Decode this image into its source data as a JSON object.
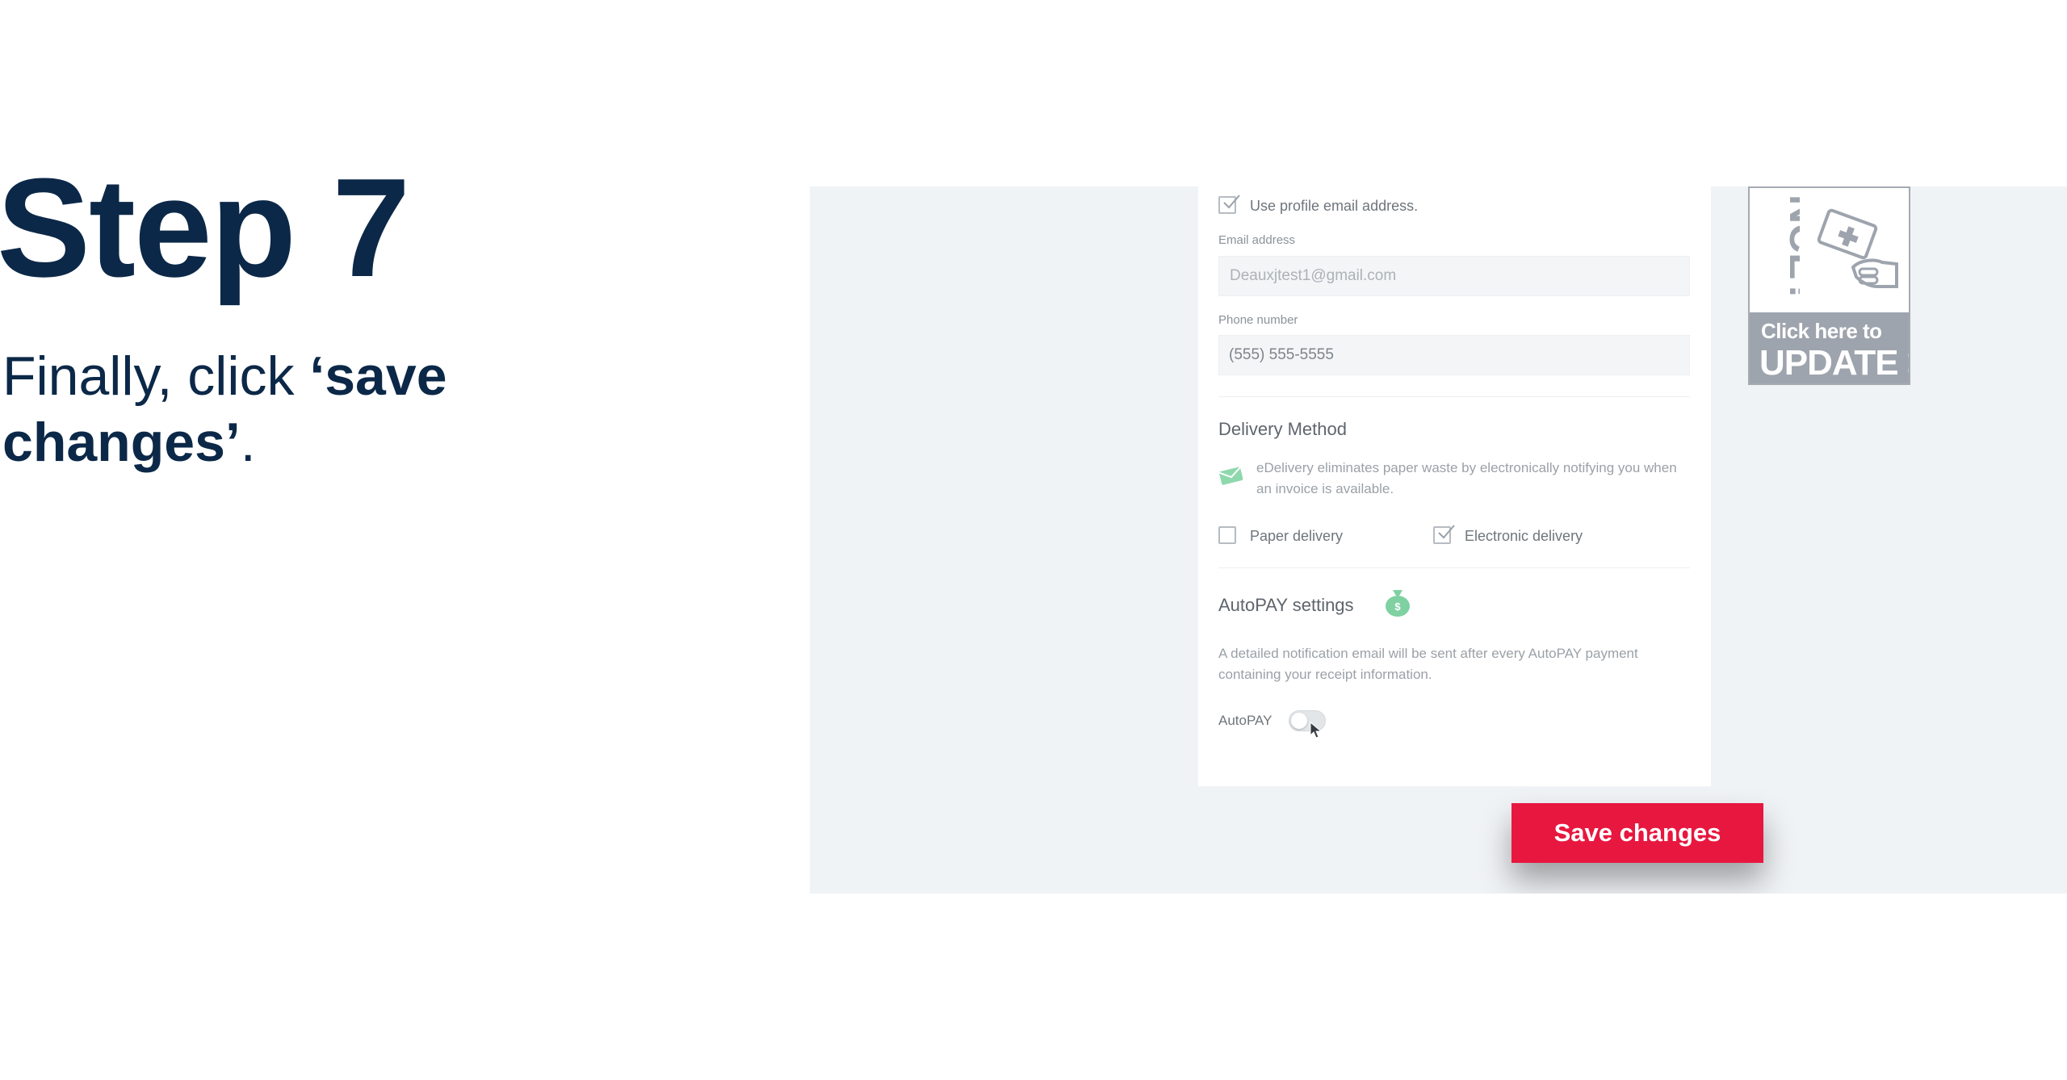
{
  "slide": {
    "title": "Step 7",
    "description_prefix": "Finally, click ",
    "description_bold": "‘save changes’",
    "description_suffix": "."
  },
  "form": {
    "use_profile_email_label": "Use profile email address.",
    "use_profile_email_checked": true,
    "email_label": "Email address",
    "email_value": "Deauxjtest1@gmail.com",
    "phone_label": "Phone number",
    "phone_value": "(555) 555-5555",
    "delivery_title": "Delivery Method",
    "edelivery_note": "eDelivery eliminates paper waste by electronically notifying you when an invoice is available.",
    "paper_delivery_label": "Paper delivery",
    "paper_delivery_checked": false,
    "electronic_delivery_label": "Electronic delivery",
    "electronic_delivery_checked": true,
    "autopay_title": "AutoPAY settings",
    "autopay_note": "A detailed notification email will be sent after every AutoPAY payment containing your receipt information.",
    "autopay_label": "AutoPAY",
    "autopay_enabled": false,
    "save_label": "Save changes"
  },
  "banner": {
    "rotated_text": "NCE?",
    "click_text": "Click here to",
    "update_text": "UPDATE >"
  },
  "colors": {
    "heading": "#0c2848",
    "save_button": "#e8173f",
    "icon_green": "#7fd1a2",
    "banner_gray": "#9ea4ad"
  }
}
